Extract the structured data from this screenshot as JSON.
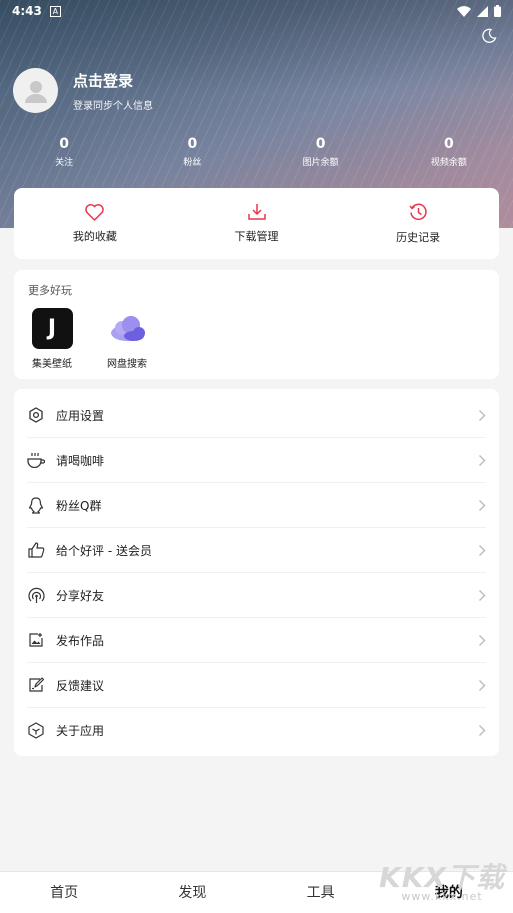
{
  "status_bar": {
    "time": "4:43",
    "notification_icon": "A"
  },
  "header": {
    "theme_icon": "moon-icon",
    "login_title": "点击登录",
    "login_subtitle": "登录同步个人信息"
  },
  "stats": [
    {
      "value": "0",
      "label": "关注"
    },
    {
      "value": "0",
      "label": "粉丝"
    },
    {
      "value": "0",
      "label": "图片余额"
    },
    {
      "value": "0",
      "label": "视频余额"
    }
  ],
  "quick_actions": [
    {
      "label": "我的收藏",
      "icon": "heart-icon"
    },
    {
      "label": "下载管理",
      "icon": "download-icon"
    },
    {
      "label": "历史记录",
      "icon": "history-icon"
    }
  ],
  "more_fun": {
    "title": "更多好玩",
    "apps": [
      {
        "label": "集美壁纸",
        "icon_text": "J"
      },
      {
        "label": "网盘搜索",
        "icon": "cloud-icon"
      }
    ]
  },
  "menu": [
    {
      "label": "应用设置",
      "icon": "gear-icon"
    },
    {
      "label": "请喝咖啡",
      "icon": "coffee-icon"
    },
    {
      "label": "粉丝Q群",
      "icon": "qq-icon"
    },
    {
      "label": "给个好评 - 送会员",
      "icon": "thumbs-up-icon"
    },
    {
      "label": "分享好友",
      "icon": "share-icon"
    },
    {
      "label": "发布作品",
      "icon": "publish-icon"
    },
    {
      "label": "反馈建议",
      "icon": "feedback-icon"
    },
    {
      "label": "关于应用",
      "icon": "about-icon"
    }
  ],
  "bottom_nav": [
    "首页",
    "发现",
    "工具",
    "我的"
  ],
  "active_tab": "我的",
  "watermark": {
    "main": "KKX下载",
    "sub": "www.kkx.net"
  },
  "colors": {
    "accent": "#e8374e",
    "icon": "#333333",
    "chevron": "#bbbbbb"
  }
}
